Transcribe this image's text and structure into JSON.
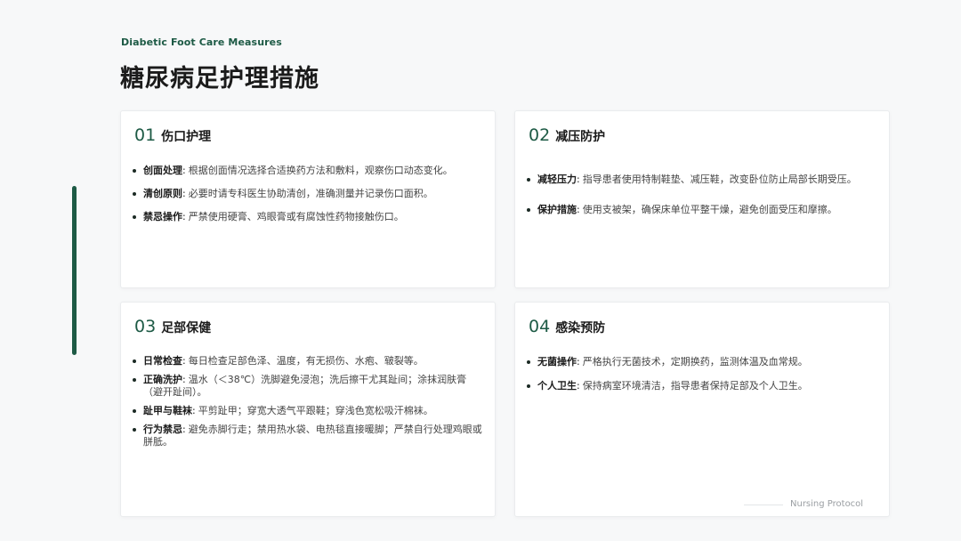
{
  "header": {
    "subtitle": "Diabetic Foot Care Measures",
    "title": "糖尿病足护理措施"
  },
  "cards": [
    {
      "num": "01",
      "title": "伤口护理",
      "items": [
        {
          "label": "创面处理",
          "text": "根据创面情况选择合适换药方法和敷料，观察伤口动态变化。"
        },
        {
          "label": "清创原则",
          "text": "必要时请专科医生协助清创，准确测量并记录伤口面积。"
        },
        {
          "label": "禁忌操作",
          "text": "严禁使用硬膏、鸡眼膏或有腐蚀性药物接触伤口。"
        }
      ]
    },
    {
      "num": "02",
      "title": "减压防护",
      "items": [
        {
          "label": "减轻压力",
          "text": "指导患者使用特制鞋垫、减压鞋，改变卧位防止局部长期受压。"
        },
        {
          "label": "保护措施",
          "text": "使用支被架，确保床单位平整干燥，避免创面受压和摩擦。"
        }
      ]
    },
    {
      "num": "03",
      "title": "足部保健",
      "items": [
        {
          "label": "日常检查",
          "text": "每日检查足部色泽、温度，有无损伤、水疱、皲裂等。"
        },
        {
          "label": "正确洗护",
          "text": "温水（＜38℃）洗脚避免浸泡；洗后擦干尤其趾间；涂抹润肤膏（避开趾间）。"
        },
        {
          "label": "趾甲与鞋袜",
          "text": "平剪趾甲；穿宽大透气平跟鞋；穿浅色宽松吸汗棉袜。"
        },
        {
          "label": "行为禁忌",
          "text": "避免赤脚行走；禁用热水袋、电热毯直接暖脚；严禁自行处理鸡眼或胼胝。"
        }
      ]
    },
    {
      "num": "04",
      "title": "感染预防",
      "items": [
        {
          "label": "无菌操作",
          "text": "严格执行无菌技术，定期换药，监测体温及血常规。"
        },
        {
          "label": "个人卫生",
          "text": "保持病室环境清洁，指导患者保持足部及个人卫生。"
        }
      ]
    }
  ],
  "footer": {
    "text": "Nursing Protocol"
  },
  "colors": {
    "accent": "#1d5a45",
    "background": "#f7f8f9",
    "card": "#ffffff"
  }
}
